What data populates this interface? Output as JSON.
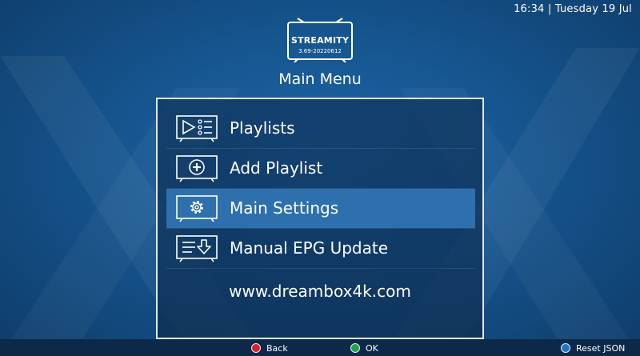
{
  "status_bar": {
    "time": "16:34",
    "separator": "|",
    "date": "Tuesday 19 Jul"
  },
  "logo": {
    "name": "STREAMITY",
    "version": "3.69-20220612"
  },
  "header": {
    "title": "Main Menu"
  },
  "menu": {
    "items": [
      {
        "label": "Playlists",
        "icon": "playlist-icon",
        "selected": false
      },
      {
        "label": "Add Playlist",
        "icon": "add-circle-icon",
        "selected": false
      },
      {
        "label": "Main Settings",
        "icon": "gear-icon",
        "selected": true
      },
      {
        "label": "Manual EPG Update",
        "icon": "download-list-icon",
        "selected": false
      }
    ],
    "website": "www.dreambox4k.com"
  },
  "footer": {
    "buttons": [
      {
        "label": "Back",
        "color": "#d8202a"
      },
      {
        "label": "OK",
        "color": "#1fa54b"
      },
      {
        "label": "Reset JSON",
        "color": "#1f72c8"
      }
    ]
  },
  "colors": {
    "background": "#16558f",
    "selection": "#2e70ad",
    "bar": "#0c2949"
  }
}
